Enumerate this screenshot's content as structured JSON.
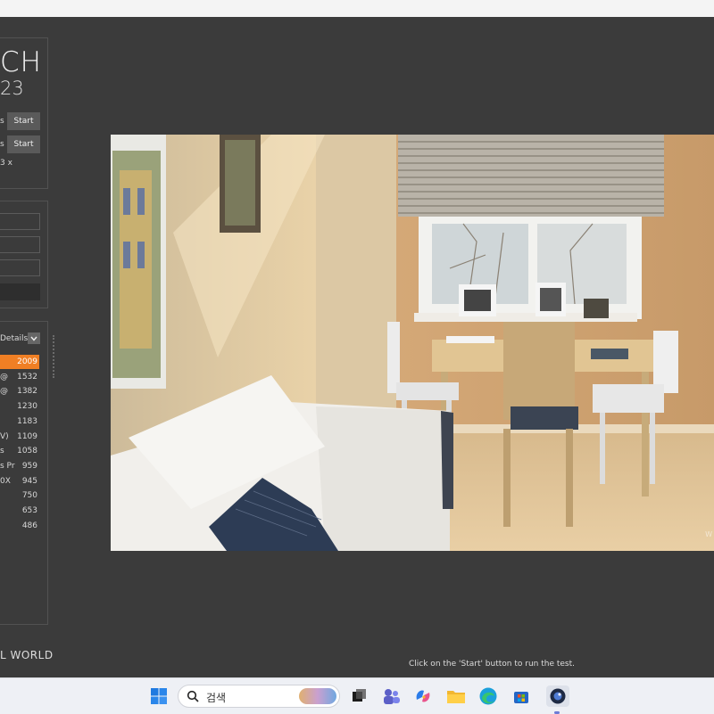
{
  "app": {
    "title_partial": "CH",
    "version_partial": "23",
    "footer_partial": "L WORLD",
    "status": "Click on the 'Start' button to run the test."
  },
  "tests": [
    {
      "label_partial": "s",
      "button": "Start"
    },
    {
      "label_partial": "s",
      "button": "Start"
    }
  ],
  "cores_partial": "3 x",
  "ranking": {
    "header_partial": "Details",
    "rows": [
      {
        "name_partial": "",
        "score": "2009",
        "highlight": true
      },
      {
        "name_partial": "@",
        "score": "1532"
      },
      {
        "name_partial": "@",
        "score": "1382"
      },
      {
        "name_partial": "",
        "score": "1230"
      },
      {
        "name_partial": "",
        "score": "1183"
      },
      {
        "name_partial": "V)",
        "score": "1109"
      },
      {
        "name_partial": "s",
        "score": "1058"
      },
      {
        "name_partial": "s Pr",
        "score": "959"
      },
      {
        "name_partial": "0X",
        "score": "945"
      },
      {
        "name_partial": "",
        "score": "750"
      },
      {
        "name_partial": "",
        "score": "653"
      },
      {
        "name_partial": "",
        "score": "486"
      }
    ]
  },
  "render": {
    "watermark_partial": "W"
  },
  "taskbar": {
    "search_text": "검색",
    "icons": [
      "windows-start-icon",
      "search-icon",
      "task-view-icon",
      "teams-icon",
      "copilot-icon",
      "file-explorer-icon",
      "edge-icon",
      "store-icon",
      "cinebench-icon"
    ]
  },
  "colors": {
    "accent": "#f07f24",
    "background": "#3b3b3b",
    "button": "#5a5a5a"
  }
}
